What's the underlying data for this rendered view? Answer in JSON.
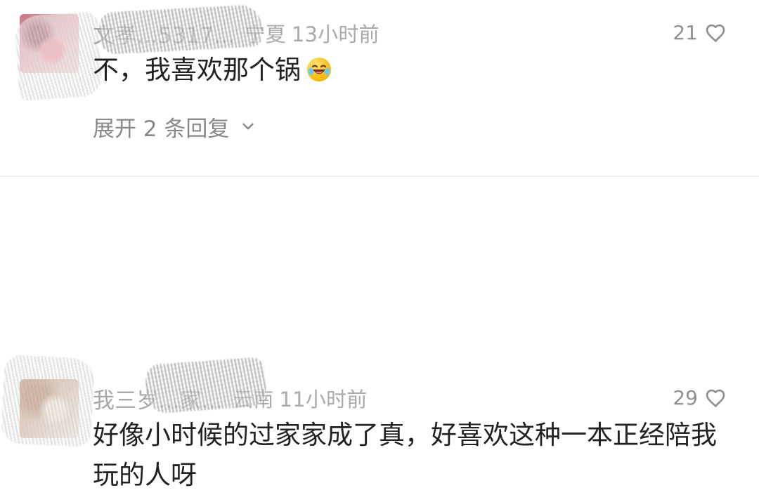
{
  "comments": [
    {
      "username": "文孝...5317...",
      "location": "宁夏",
      "time": "13小时前",
      "likes": "21",
      "content": "不，我喜欢那个锅",
      "emoji": "laughing-crying-emoji",
      "replies_label": "展开 2 条回复",
      "colors": {
        "primary_text": "#222222",
        "secondary_text": "#aaaaaa"
      }
    },
    {
      "username": "我三岁...家...",
      "location": "云南",
      "time": "11小时前",
      "likes": "29",
      "content": "好像小时候的过家家成了真，好喜欢这种一本正经陪我玩的人呀",
      "colors": {
        "primary_text": "#222222",
        "secondary_text": "#aaaaaa"
      }
    }
  ],
  "icons": {
    "heart": "heart-icon",
    "chevron_down": "chevron-down-icon",
    "emoji": "laughing-crying-emoji"
  }
}
